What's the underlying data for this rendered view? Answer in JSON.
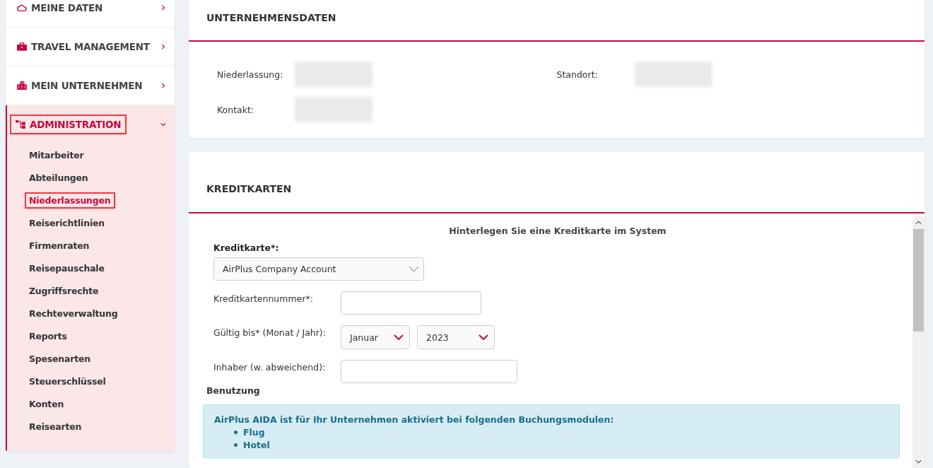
{
  "sidebar": {
    "items": [
      {
        "label": "MEINE DATEN",
        "expanded": false,
        "highlighted": false
      },
      {
        "label": "TRAVEL MANAGEMENT",
        "expanded": false,
        "highlighted": false
      },
      {
        "label": "MEIN UNTERNEHMEN",
        "expanded": false,
        "highlighted": false
      },
      {
        "label": "ADMINISTRATION",
        "expanded": true,
        "highlighted": true,
        "children": [
          {
            "label": "Mitarbeiter",
            "selected": false,
            "highlighted": false
          },
          {
            "label": "Abteilungen",
            "selected": false,
            "highlighted": false
          },
          {
            "label": "Niederlassungen",
            "selected": true,
            "highlighted": true
          },
          {
            "label": "Reiserichtlinien",
            "selected": false,
            "highlighted": false
          },
          {
            "label": "Firmenraten",
            "selected": false,
            "highlighted": false
          },
          {
            "label": "Reisepauschale",
            "selected": false,
            "highlighted": false
          },
          {
            "label": "Zugriffsrechte",
            "selected": false,
            "highlighted": false
          },
          {
            "label": "Rechteverwaltung",
            "selected": false,
            "highlighted": false
          },
          {
            "label": "Reports",
            "selected": false,
            "highlighted": false
          },
          {
            "label": "Spesenarten",
            "selected": false,
            "highlighted": false
          },
          {
            "label": "Steuerschlüssel",
            "selected": false,
            "highlighted": false
          },
          {
            "label": "Konten",
            "selected": false,
            "highlighted": false
          },
          {
            "label": "Reisearten",
            "selected": false,
            "highlighted": false
          }
        ]
      }
    ]
  },
  "company": {
    "title": "UNTERNEHMENSDATEN",
    "fields": [
      {
        "label": "Niederlassung:",
        "redacted": true
      },
      {
        "label": "Standort:",
        "redacted": true
      },
      {
        "label": "Kontakt:",
        "redacted": true
      }
    ]
  },
  "credit_cards": {
    "title": "KREDITKARTEN",
    "intro": "Hinterlegen Sie eine Kreditkarte im System",
    "card_label": "Kreditkarte*:",
    "card_value": "AirPlus Company Account",
    "number_label": "Kreditkartennummer*:",
    "valid_label": "Gültig bis* (Monat / Jahr):",
    "month": "Januar",
    "year": "2023",
    "holder_label": "Inhaber (w. abweichend):",
    "usage_title": "Benutzung",
    "info": {
      "text": "AirPlus AIDA ist für Ihr Unternehmen aktiviert bei folgenden Buchungsmodulen:",
      "items": [
        "Flug",
        "Hotel"
      ]
    }
  }
}
